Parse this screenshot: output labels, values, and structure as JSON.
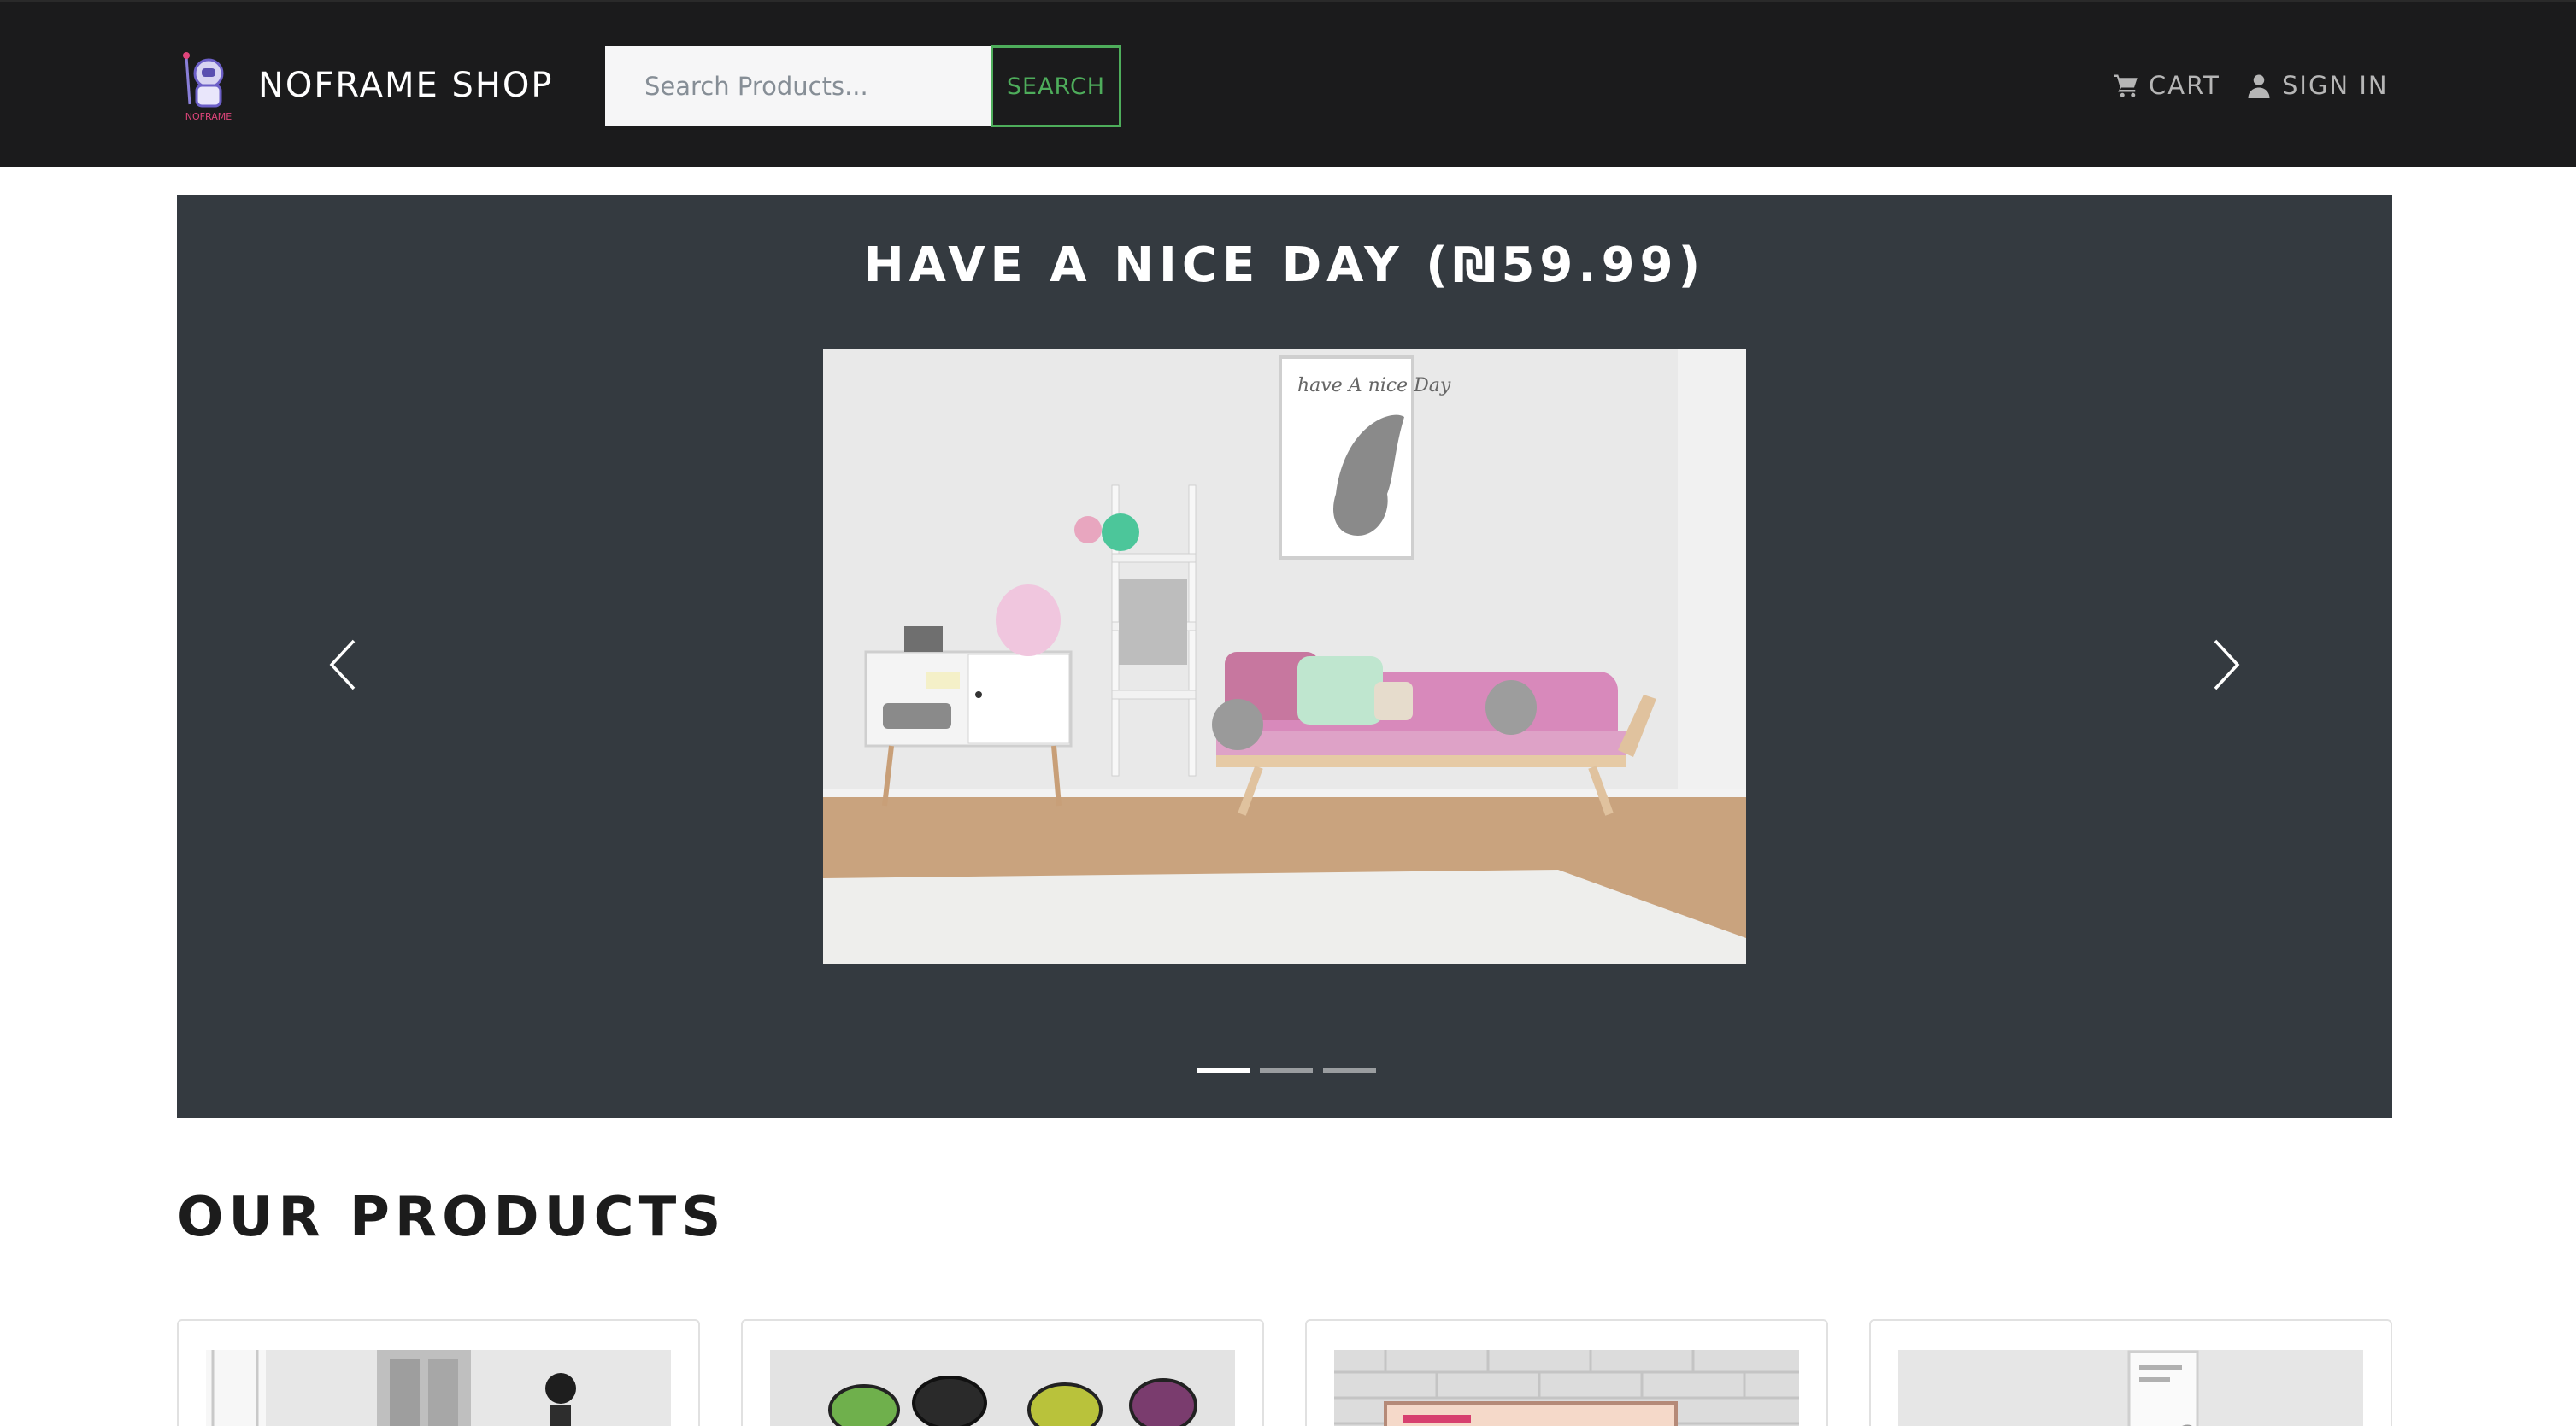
{
  "navbar": {
    "brand_name": "NOFRAME SHOP",
    "brand_logo_text": "NOFRAME",
    "search_placeholder": "Search Products...",
    "search_button_label": "SEARCH",
    "cart_label": "CART",
    "signin_label": "SIGN IN",
    "icons": {
      "cart": "cart-icon",
      "user": "user-icon"
    },
    "accent_color": "#4ead5b",
    "background_color": "#1b1b1c"
  },
  "carousel": {
    "title": "HAVE A NICE DAY (₪59.99)",
    "image_poster_text": "have A nice Day",
    "background_color": "#343a40",
    "slide_count": 3,
    "active_slide_index": 0
  },
  "products": {
    "section_title": "OUR PRODUCTS",
    "cards": [
      {
        "thumbnail": "wall-art-room"
      },
      {
        "thumbnail": "cartoon-stickers"
      },
      {
        "thumbnail": "sign-on-brick-wall"
      },
      {
        "thumbnail": "butterfly-poster"
      }
    ]
  }
}
